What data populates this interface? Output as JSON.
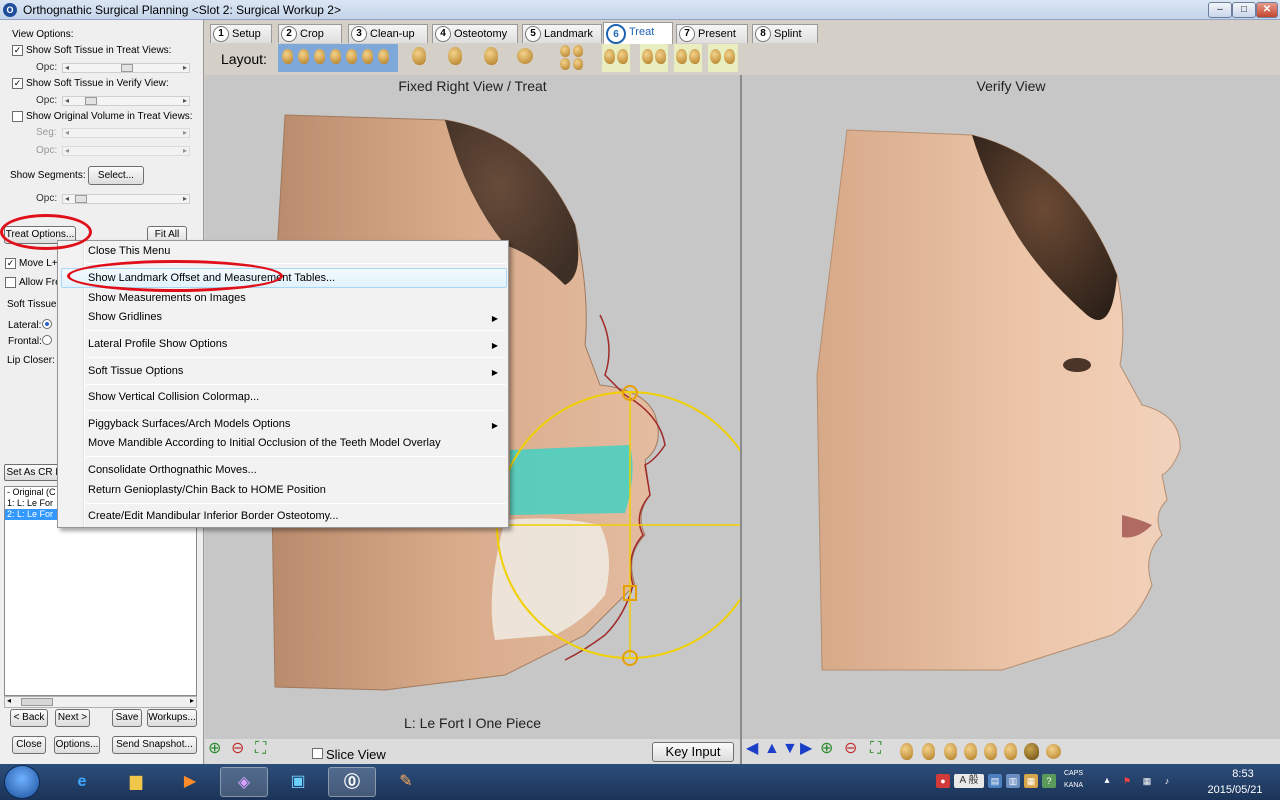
{
  "window": {
    "title": "Orthognathic Surgical Planning <Slot 2: Surgical Workup 2>",
    "app_icon_letter": "O",
    "min_label": "–",
    "max_label": "□",
    "close_label": "✕"
  },
  "tabs": [
    {
      "num": "1",
      "label": "Setup"
    },
    {
      "num": "2",
      "label": "Crop"
    },
    {
      "num": "3",
      "label": "Clean-up"
    },
    {
      "num": "4",
      "label": "Osteotomy"
    },
    {
      "num": "5",
      "label": "Landmark"
    },
    {
      "num": "6",
      "label": "Treat",
      "active": true
    },
    {
      "num": "7",
      "label": "Present"
    },
    {
      "num": "8",
      "label": "Splint"
    }
  ],
  "layout_label": "Layout:",
  "left_panel": {
    "view_options_label": "View Options:",
    "show_soft_tissue_treat": "Show Soft Tissue in Treat Views:",
    "show_soft_tissue_verify": "Show Soft Tissue in Verify View:",
    "show_original_volume": "Show Original Volume in Treat Views:",
    "opc_label": "Opc:",
    "seg_label": "Seg:",
    "show_segments_label": "Show Segments:",
    "select_button": "Select...",
    "treat_options_button": "Treat Options...",
    "fit_all_button": "Fit All",
    "move_label": "Move L+",
    "allow_label": "Allow Fre",
    "soft_tissue_label": "Soft Tissue",
    "lateral_label": "Lateral:",
    "frontal_label": "Frontal:",
    "lip_closer_label": "Lip Closer:",
    "set_as_cr_button": "Set As CR F",
    "list_items": [
      {
        "label": "- Original (C",
        "selected": false
      },
      {
        "label": "1: L: Le For",
        "selected": false
      },
      {
        "label": "2: L: Le For",
        "selected": true
      }
    ],
    "back_button": "< Back",
    "next_button": "Next >",
    "save_button": "Save",
    "workups_button": "Workups...",
    "close_button": "Close",
    "options_button": "Options...",
    "send_snapshot_button": "Send Snapshot..."
  },
  "context_menu": {
    "items": [
      {
        "label": "Close This Menu",
        "submenu": false
      },
      {
        "label": "Show Landmark Offset and Measurement Tables...",
        "submenu": false
      },
      {
        "label": "Show Measurements on Images",
        "submenu": false
      },
      {
        "label": "Show Gridlines",
        "submenu": true
      },
      {
        "label": "Lateral Profile Show Options",
        "submenu": true
      },
      {
        "label": "Soft Tissue Options",
        "submenu": true
      },
      {
        "label": "Show Vertical Collision Colormap...",
        "submenu": false
      },
      {
        "label": "Piggyback Surfaces/Arch Models Options",
        "submenu": true
      },
      {
        "label": "Move Mandible According to Initial Occlusion of the Teeth Model Overlay",
        "submenu": false
      },
      {
        "label": "Consolidate Orthognathic Moves...",
        "submenu": false
      },
      {
        "label": "Return Genioplasty/Chin Back to HOME Position",
        "submenu": false
      },
      {
        "label": "Create/Edit Mandibular Inferior Border Osteotomy...",
        "submenu": false
      }
    ],
    "submenu_arrow": "▶"
  },
  "views": {
    "left_title": "Fixed Right View / Treat",
    "right_title": "Verify View",
    "left_caption": "L: Le Fort I One Piece"
  },
  "bottom_left": {
    "slice_view_label": "Slice View",
    "key_input_button": "Key Input"
  },
  "taskbar": {
    "time": "8:53",
    "date": "2015/05/21",
    "caps_label": "CAPS",
    "kana_label": "KANA",
    "ime_label": "A 般"
  },
  "colors": {
    "accent": "#1e64b4",
    "highlight_ring": "#e0101a",
    "overlay_yellow": "#f0d000",
    "maxilla_teal": "#4ccfc0",
    "skin": "#d9ac8c"
  }
}
